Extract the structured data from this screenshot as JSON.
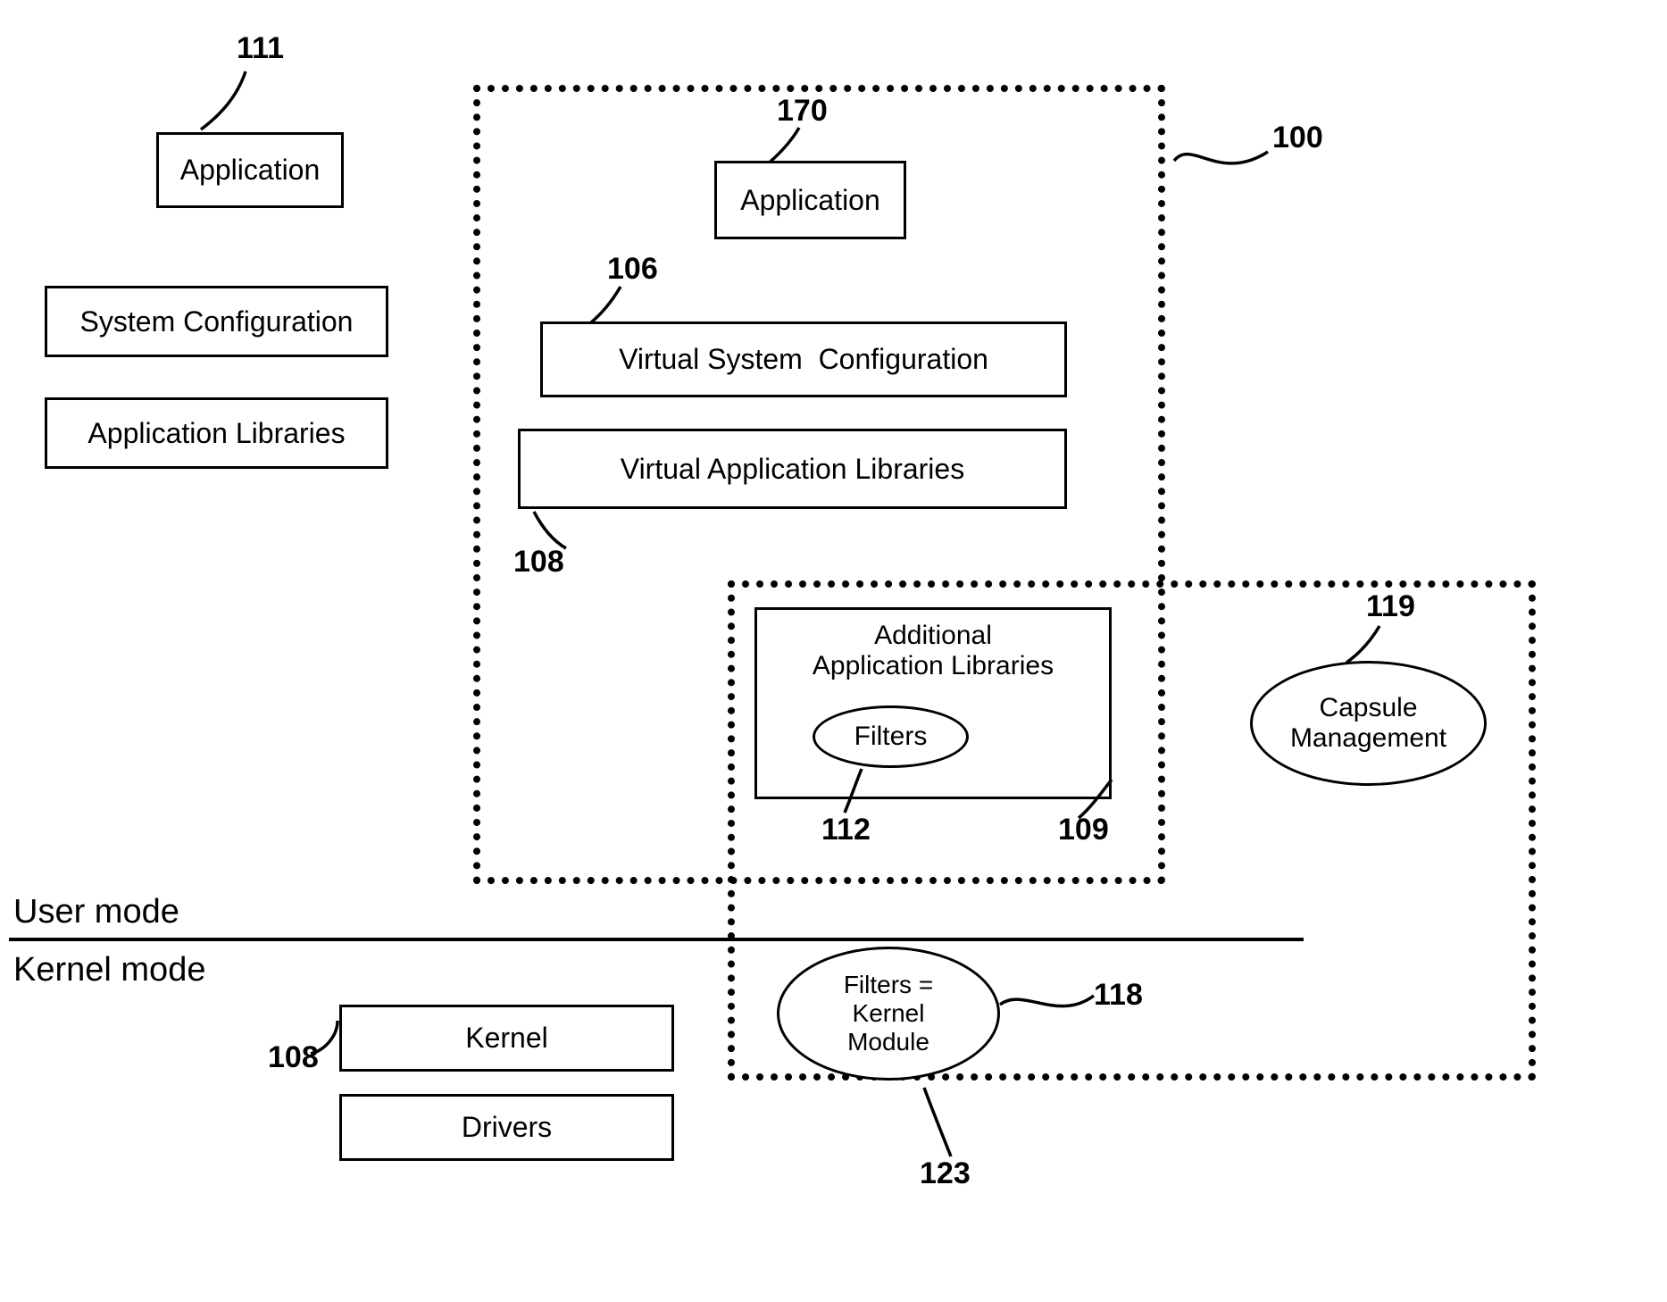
{
  "ref": {
    "n111": "111",
    "n170": "170",
    "n100": "100",
    "n106": "106",
    "n108a": "108",
    "n112": "112",
    "n109": "109",
    "n119": "119",
    "n118": "118",
    "n108b": "108",
    "n123": "123"
  },
  "boxes": {
    "application_left": "Application",
    "system_configuration": "System Configuration",
    "application_libraries": "Application Libraries",
    "application_right": "Application",
    "virtual_system_configuration": "Virtual System  Configuration",
    "virtual_application_libraries": "Virtual Application Libraries",
    "additional_application_libraries": "Additional\nApplication Libraries",
    "kernel": "Kernel",
    "drivers": "Drivers"
  },
  "ellipses": {
    "filters": "Filters",
    "capsule_management": "Capsule\nManagement",
    "filters_kernel_module": "Filters =\nKernel\nModule"
  },
  "labels": {
    "user_mode": "User mode",
    "kernel_mode": "Kernel mode"
  }
}
